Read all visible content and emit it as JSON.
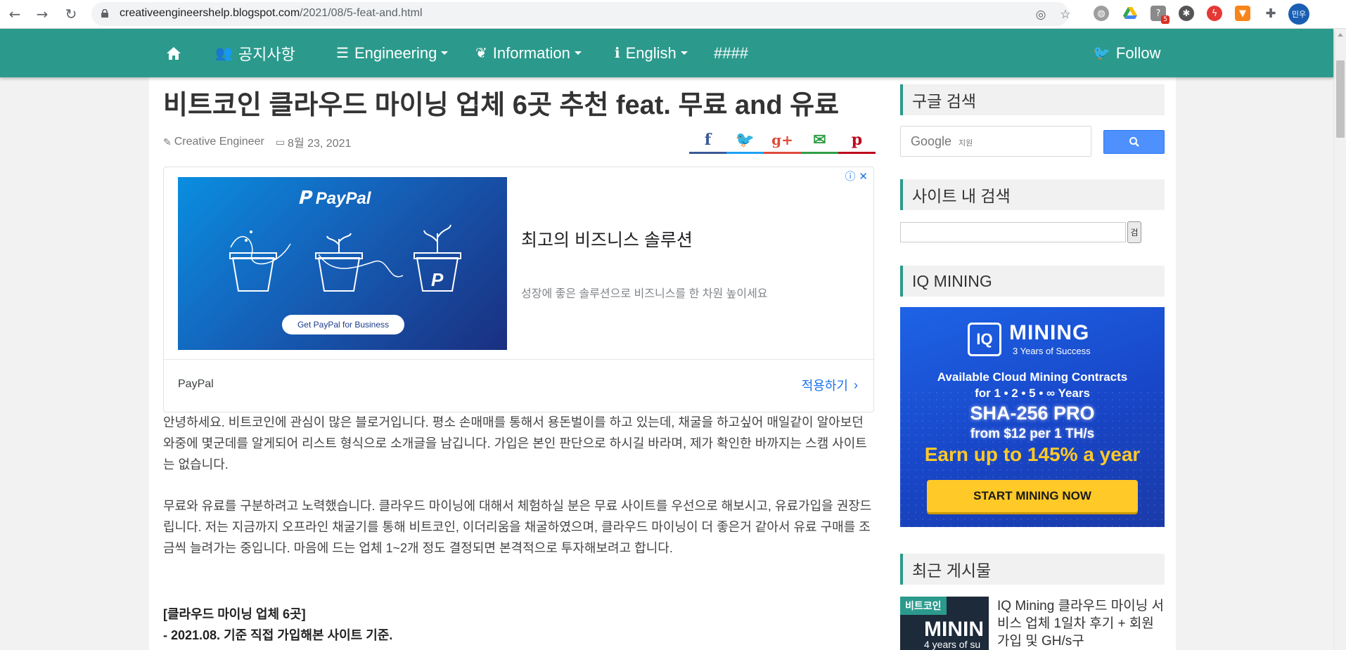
{
  "browser": {
    "url_host": "creativeengineershelp.blogspot.com",
    "url_path": "/2021/08/5-feat-and.html",
    "back_icon": "arrow-left-icon",
    "forward_icon": "arrow-right-icon",
    "reload_icon": "reload-icon",
    "ext_badge": "5",
    "profile_label": "민우"
  },
  "nav": {
    "home_icon": "home-icon",
    "items": [
      {
        "label": "공지사항"
      },
      {
        "label": "Engineering"
      },
      {
        "label": "Information"
      },
      {
        "label": "English"
      },
      {
        "label": "####"
      }
    ],
    "follow_label": "Follow",
    "bg_color": "#2b9a8c"
  },
  "post": {
    "title": "비트코인 클라우드 마이닝 업체 6곳 추천 feat. 무료 and 유료",
    "author": "Creative Engineer",
    "date": "8월 23, 2021",
    "share": [
      "f",
      "t",
      "g+",
      "✉",
      "p"
    ]
  },
  "ad": {
    "brand": "PayPal",
    "banner_button": "Get PayPal for Business",
    "headline": "최고의 비즈니스 솔루션",
    "description": "성장에 좋은 솔루션으로 비즈니스를 한 차원 높이세요",
    "advertiser": "PayPal",
    "cta": "적용하기"
  },
  "body": {
    "paragraph1": " 안녕하세요. 비트코인에 관심이 많은 블로거입니다. 평소 손매매를 통해서 용돈벌이를 하고 있는데, 채굴을 하고싶어 매일같이 알아보던 와중에 몇군데를 알게되어 리스트 형식으로 소개글을 남깁니다. 가입은 본인 판단으로 하시길 바라며, 제가 확인한 바까지는 스캠 사이트는 없습니다.",
    "paragraph2": "무료와 유료를 구분하려고 노력했습니다. 클라우드 마이닝에 대해서 체험하실 분은 무료 사이트를 우선으로 해보시고, 유료가입을 권장드립니다. 저는 지금까지 오프라인 채굴기를 통해 비트코인, 이더리움을 채굴하였으며, 클라우드 마이닝이 더 좋은거 같아서 유료 구매를 조금씩 늘려가는 중입니다. 마음에 드는 업체 1~2개 정도 결정되면 본격적으로 투자해보려고 합니다.",
    "heading1": "[클라우드 마이닝 업체 6곳]",
    "heading2": " - 2021.08. 기준 직접 가입해본 사이트 기준."
  },
  "sidebar": {
    "google_search_title": "구글 검색",
    "google_logo": "Google",
    "google_sub": "지원",
    "site_search_title": "사이트 내 검색",
    "site_search_btn": "검",
    "iq_title": "IQ MINING",
    "iq": {
      "logo": "IQ",
      "brand": "MINING",
      "years": "3 Years of Success",
      "line1": "Available Cloud Mining Contracts",
      "line2": "for 1 • 2 • 5 • ∞ Years",
      "sha": "SHA-256 PRO",
      "from": "from $12 per 1 TH/s",
      "earn": "Earn up to 145% a year",
      "cta": "START MINING NOW"
    },
    "recent_title": "최근 게시물",
    "recent_post": {
      "tag": "비트코인",
      "thumb_text": "MININ",
      "thumb_sub": "4 years of su",
      "title": "IQ Mining 클라우드 마이닝 서비스 업체 1일차 후기 + 회원가입 및 GH/s구"
    }
  }
}
